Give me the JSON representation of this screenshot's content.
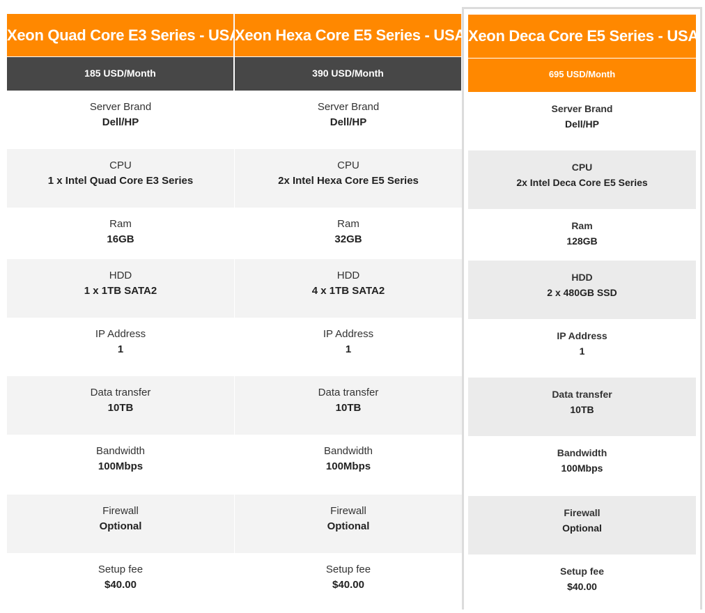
{
  "plans": [
    {
      "title": "Xeon Quad Core E3 Series - USA",
      "price": "185 USD/Month",
      "features": [
        {
          "label": "Server Brand",
          "value": "Dell/HP"
        },
        {
          "label": "CPU",
          "value": "1 x Intel Quad Core E3 Series"
        },
        {
          "label": "Ram",
          "value": "16GB"
        },
        {
          "label": "HDD",
          "value": "1 x 1TB SATA2"
        },
        {
          "label": "IP Address",
          "value": "1"
        },
        {
          "label": "Data transfer",
          "value": "10TB"
        },
        {
          "label": "Bandwidth",
          "value": "100Mbps"
        },
        {
          "label": "Firewall",
          "value": "Optional"
        },
        {
          "label": "Setup fee",
          "value": "$40.00"
        }
      ]
    },
    {
      "title": "Xeon Hexa Core E5 Series - USA",
      "price": "390 USD/Month",
      "features": [
        {
          "label": "Server Brand",
          "value": "Dell/HP"
        },
        {
          "label": "CPU",
          "value": "2x Intel Hexa Core E5 Series"
        },
        {
          "label": "Ram",
          "value": "32GB"
        },
        {
          "label": "HDD",
          "value": "4 x 1TB SATA2"
        },
        {
          "label": "IP Address",
          "value": "1"
        },
        {
          "label": "Data transfer",
          "value": "10TB"
        },
        {
          "label": "Bandwidth",
          "value": "100Mbps"
        },
        {
          "label": "Firewall",
          "value": "Optional"
        },
        {
          "label": "Setup fee",
          "value": "$40.00"
        }
      ]
    },
    {
      "title": "Xeon Deca Core E5 Series - USA",
      "price": "695 USD/Month",
      "features": [
        {
          "label": "Server Brand",
          "value": "Dell/HP"
        },
        {
          "label": "CPU",
          "value": "2x Intel Deca Core E5 Series"
        },
        {
          "label": "Ram",
          "value": "128GB"
        },
        {
          "label": "HDD",
          "value": "2 x 480GB SSD"
        },
        {
          "label": "IP Address",
          "value": "1"
        },
        {
          "label": "Data transfer",
          "value": "10TB"
        },
        {
          "label": "Bandwidth",
          "value": "100Mbps"
        },
        {
          "label": "Firewall",
          "value": "Optional"
        },
        {
          "label": "Setup fee",
          "value": "$40.00"
        }
      ]
    }
  ],
  "colors": {
    "accent": "#ff8800",
    "price_bar": "#474747",
    "row_alt": "#f3f3f3"
  }
}
